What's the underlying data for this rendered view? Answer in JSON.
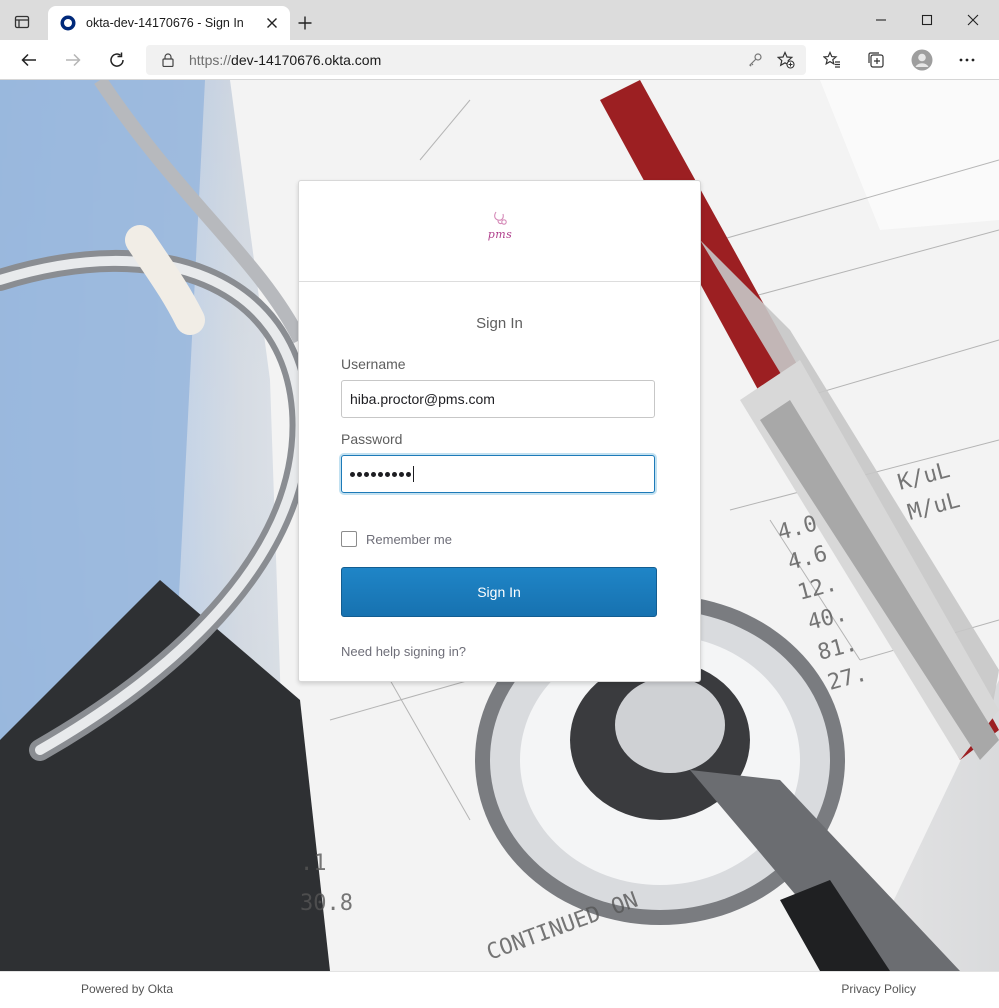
{
  "browser": {
    "tab_title": "okta-dev-14170676 - Sign In",
    "url_scheme": "https://",
    "url_host": "dev-14170676.okta.com",
    "icons": {
      "tab_actions": "tab-actions-icon",
      "favicon": "okta-favicon-icon",
      "close": "close-icon",
      "new_tab": "plus-icon",
      "back": "back-arrow-icon",
      "forward": "forward-arrow-icon",
      "refresh": "refresh-icon",
      "lock": "lock-icon",
      "key": "key-icon",
      "add_favorite": "star-plus-icon",
      "favorites": "favorites-icon",
      "collections": "collections-icon",
      "profile": "avatar-icon",
      "menu": "more-icon"
    }
  },
  "logo": {
    "text": "pms",
    "color": "#b0408c"
  },
  "form": {
    "title": "Sign In",
    "username_label": "Username",
    "username_value": "hiba.proctor@pms.com",
    "password_label": "Password",
    "password_length": 9,
    "remember_label": "Remember me",
    "submit_label": "Sign In",
    "help_link": "Need help signing in?"
  },
  "footer": {
    "powered_by": "Powered by Okta",
    "privacy": "Privacy Policy"
  },
  "colors": {
    "primary_button": "#1772b0",
    "focus": "#1d7ab8"
  }
}
